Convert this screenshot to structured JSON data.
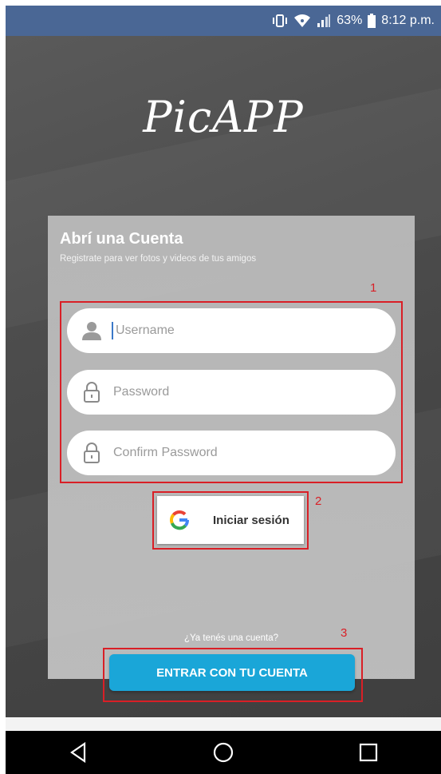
{
  "status_bar": {
    "battery_percent": "63%",
    "time": "8:12 p.m.",
    "icons": [
      "vibrate-icon",
      "wifi-icon",
      "signal-icon",
      "battery-icon"
    ]
  },
  "app": {
    "logo_text": "PicAPP"
  },
  "register_card": {
    "title": "Abrí una Cuenta",
    "subtitle": "Registrate para ver fotos y videos de tus amigos",
    "fields": [
      {
        "placeholder": "Username",
        "value": "",
        "icon": "user-icon"
      },
      {
        "placeholder": "Password",
        "value": "",
        "icon": "lock-icon"
      },
      {
        "placeholder": "Confirm Password",
        "value": "",
        "icon": "lock-icon"
      }
    ],
    "google_button_label": "Iniciar sesión",
    "have_account_text": "¿Ya tenés una cuenta?",
    "enter_button_label": "ENTRAR CON TU CUENTA"
  },
  "annotations": [
    "1",
    "2",
    "3"
  ],
  "nav_bar": {
    "icons": [
      "back-icon",
      "home-icon",
      "recents-icon"
    ]
  },
  "colors": {
    "status_bar_bg": "#4a6795",
    "annotation_red": "#d91f26",
    "enter_button_bg": "#1aa6d8"
  }
}
